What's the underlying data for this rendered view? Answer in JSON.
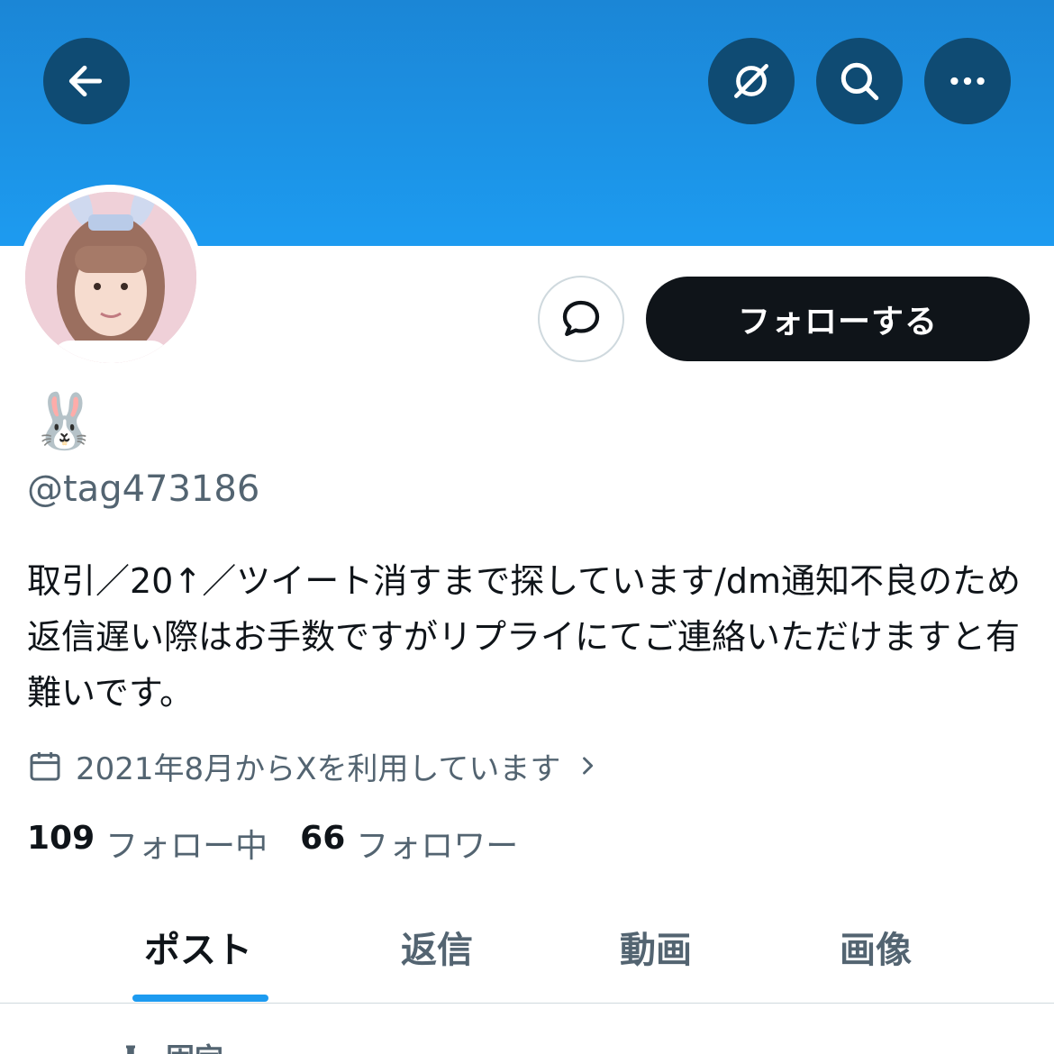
{
  "header": {
    "back_icon": "arrow-left-icon",
    "grok_icon": "grok-icon",
    "search_icon": "search-icon",
    "more_icon": "more-horizontal-icon",
    "banner_color": "#1d9bf0"
  },
  "profile": {
    "display_name": "🐰",
    "handle": "@tag473186",
    "bio": "取引／20↑／ツイート消すまで探しています/dm通知不良のため返信遅い際はお手数ですがリプライにてご連絡いただけますと有難いです。",
    "joined": "2021年8月からXを利用しています",
    "following_count": "109",
    "following_label": "フォロー中",
    "followers_count": "66",
    "followers_label": "フォロワー"
  },
  "actions": {
    "message_icon": "message-bubble-icon",
    "follow_label": "フォローする"
  },
  "tabs": [
    {
      "label": "ポスト",
      "active": true
    },
    {
      "label": "返信",
      "active": false
    },
    {
      "label": "動画",
      "active": false
    },
    {
      "label": "画像",
      "active": false
    }
  ],
  "pinned": {
    "label": "固定"
  },
  "colors": {
    "accent": "#1d9bf0",
    "text_primary": "#0f1419",
    "text_secondary": "#536471"
  }
}
